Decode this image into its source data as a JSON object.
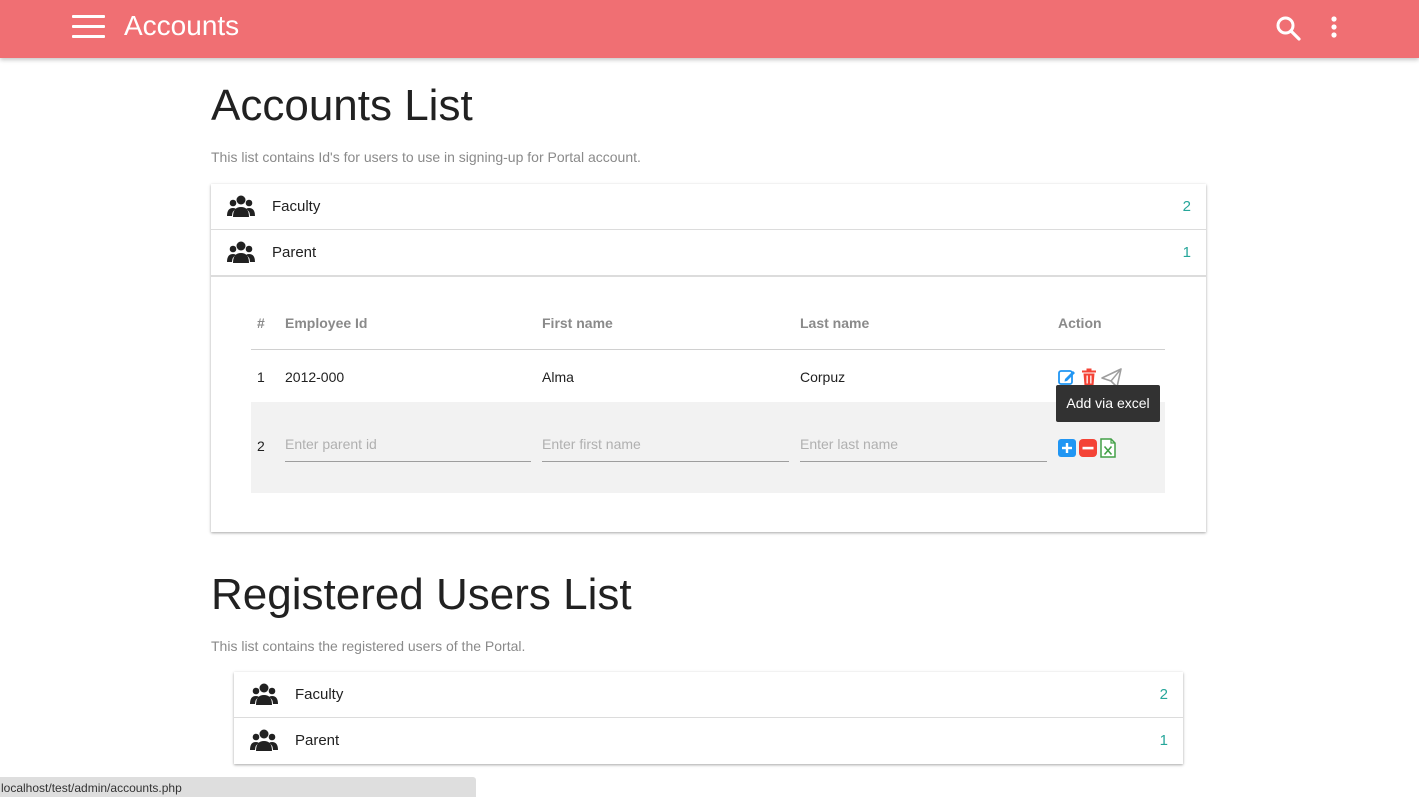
{
  "appbar": {
    "title": "Accounts",
    "background_color": "#f06f73",
    "icons": {
      "menu": "hamburger-icon",
      "search": "search-icon",
      "more": "more-vertical-icon"
    }
  },
  "accounts_section": {
    "title": "Accounts List",
    "description": "This list contains Id's for users to use in signing-up for Portal account.",
    "groups": [
      {
        "label": "Faculty",
        "count": "2",
        "icon": "users-group-icon"
      },
      {
        "label": "Parent",
        "count": "1",
        "icon": "users-group-icon"
      }
    ],
    "table": {
      "headers": [
        "#",
        "Employee Id",
        "First name",
        "Last name",
        "Action"
      ],
      "rows": [
        {
          "num": "1",
          "employee_id": "2012-000",
          "first_name": "Alma",
          "last_name": "Corpuz",
          "actions": [
            "edit-icon",
            "trash-icon",
            "send-icon"
          ]
        }
      ],
      "new_row": {
        "num": "2",
        "parent_id_placeholder": "Enter parent id",
        "first_name_placeholder": "Enter first name",
        "last_name_placeholder": "Enter last name",
        "actions": [
          "plus-square-icon",
          "minus-square-icon",
          "excel-icon"
        ]
      }
    },
    "tooltip": "Add via excel"
  },
  "registered_section": {
    "title": "Registered Users List",
    "description": "This list contains the registered users of the Portal.",
    "groups": [
      {
        "label": "Faculty",
        "count": "2",
        "icon": "users-group-icon"
      },
      {
        "label": "Parent",
        "count": "1",
        "icon": "users-group-icon"
      }
    ]
  },
  "status_bar": {
    "url": "localhost/test/admin/accounts.php"
  },
  "colors": {
    "accent": "#f06f73",
    "count": "#26a69a",
    "edit": "#2196f3",
    "delete": "#f44336",
    "excel": "#43a047"
  }
}
